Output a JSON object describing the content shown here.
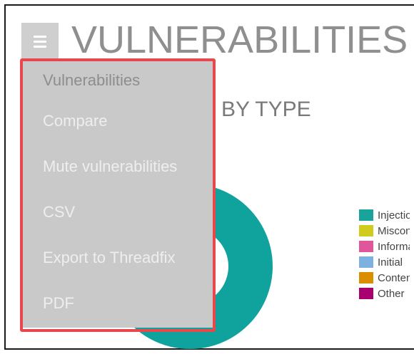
{
  "header": {
    "title": "VULNERABILITIES",
    "menu_icon": "hamburger-icon"
  },
  "section": {
    "title": "BY TYPE"
  },
  "menu": {
    "items": [
      {
        "label": "Vulnerabilities"
      },
      {
        "label": "Compare"
      },
      {
        "label": "Mute vulnerabilities"
      },
      {
        "label": "CSV"
      },
      {
        "label": "Export to Threadfix"
      },
      {
        "label": "PDF"
      }
    ],
    "highlight_color": "#e8474b",
    "background_color": "#c9c9c9"
  },
  "legend": {
    "items": [
      {
        "label": "Injection",
        "color": "#1aa39b"
      },
      {
        "label": "Misconfiguration",
        "color": "#cfcc1d"
      },
      {
        "label": "Information",
        "color": "#e0569a"
      },
      {
        "label": "Initial",
        "color": "#7eb1df"
      },
      {
        "label": "Content",
        "color": "#d98f00"
      },
      {
        "label": "Other",
        "color": "#a8006f"
      }
    ]
  },
  "chart": {
    "donut_color": "#10a39d"
  }
}
